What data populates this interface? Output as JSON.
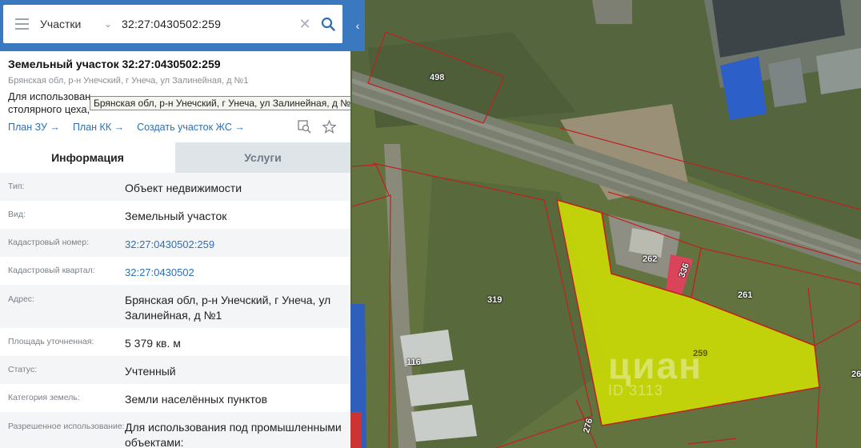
{
  "search": {
    "layer": "Участки",
    "query": "32:27:0430502:259"
  },
  "parcel": {
    "title": "Земельный участок 32:27:0430502:259",
    "address": "Брянская обл, р-н Унечский, г Унеча, ул Залинейная, д №1",
    "purpose_line1": "Для использован",
    "purpose_line2": "столярного цеха,",
    "tooltip": "Брянская обл, р-н Унечский, г Унеча, ул Залинейная, д №1"
  },
  "links": {
    "plan_zu": "План ЗУ →",
    "plan_kk": "План КК →",
    "create_zs": "Создать участок ЖС →"
  },
  "tabs": {
    "info": "Информация",
    "services": "Услуги"
  },
  "rows": [
    {
      "label": "Тип:",
      "value": "Объект недвижимости"
    },
    {
      "label": "Вид:",
      "value": "Земельный участок"
    },
    {
      "label": "Кадастровый номер:",
      "value": "32:27:0430502:259"
    },
    {
      "label": "Кадастровый квартал:",
      "value": "32:27:0430502"
    },
    {
      "label": "Адрес:",
      "value": "Брянская обл, р-н Унечский, г Унеча, ул Залинейная, д №1"
    },
    {
      "label": "Площадь уточненная:",
      "value": "5 379 кв. м"
    },
    {
      "label": "Статус:",
      "value": "Учтенный"
    },
    {
      "label": "Категория земель:",
      "value": "Земли населённых пунктов"
    },
    {
      "label": "Разрешенное использование:",
      "value": "Для использования под промышленными объектами:"
    }
  ],
  "map_labels": {
    "p498": "498",
    "p262": "262",
    "p336": "336",
    "p261": "261",
    "p319": "319",
    "p259": "259",
    "p116": "116",
    "p276": "276",
    "p26x": "26"
  },
  "watermark": {
    "logo": "циан",
    "id": "ID 3113"
  },
  "colors": {
    "accent": "#3a78bf",
    "link": "#2e6fb5",
    "parcel_border": "#c0201f",
    "selected_parcel": "#d7e600"
  },
  "icons": [
    "menu-icon",
    "chevron-down-icon",
    "close-icon",
    "search-icon",
    "collapse-icon",
    "zoom-to-icon",
    "star-icon"
  ]
}
